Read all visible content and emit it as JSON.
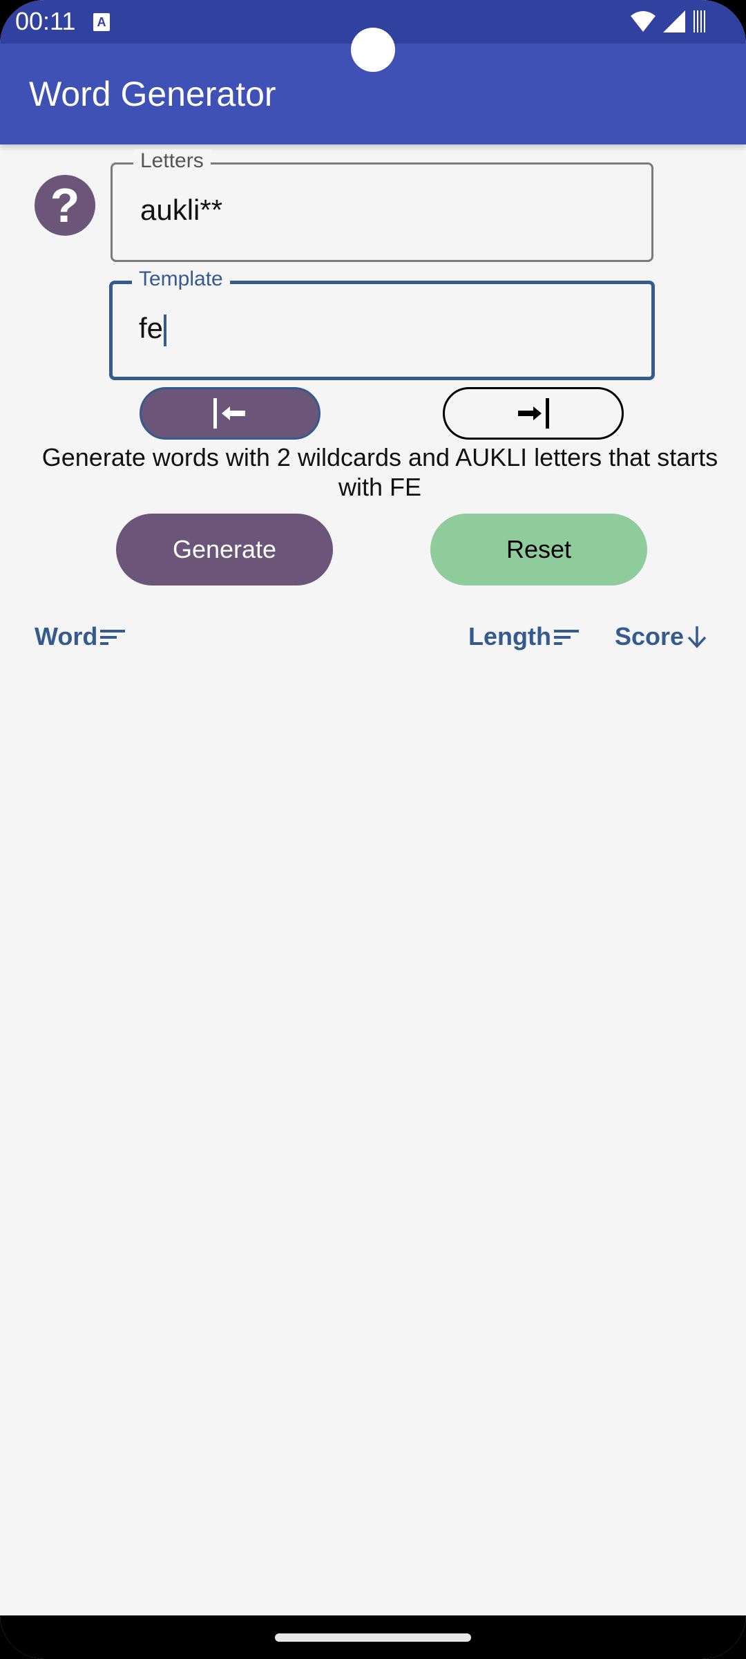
{
  "status_bar": {
    "time": "00:11",
    "notification_icon": "keyboard-a-icon",
    "icons": [
      "wifi-icon",
      "signal-icon",
      "battery-icon"
    ]
  },
  "app_bar": {
    "title": "Word Generator"
  },
  "help_button": {
    "icon": "question-icon",
    "glyph": "?"
  },
  "letters_field": {
    "label": "Letters",
    "value": "aukli**"
  },
  "template_field": {
    "label": "Template",
    "value": "fe"
  },
  "position_toggle": {
    "left": {
      "icon": "align-start-icon",
      "glyph": "|←",
      "selected": true
    },
    "right": {
      "icon": "align-end-icon",
      "glyph": "→|",
      "selected": false
    }
  },
  "description": "Generate words with 2 wildcards and AUKLI letters that starts with FE",
  "actions": {
    "generate_label": "Generate",
    "reset_label": "Reset"
  },
  "table": {
    "columns": [
      {
        "label": "Word",
        "sort_icon": "sort-icon"
      },
      {
        "label": "Length",
        "sort_icon": "sort-icon"
      },
      {
        "label": "Score",
        "sort_icon": "arrow-down-icon"
      }
    ],
    "rows": []
  },
  "colors": {
    "primary": "#3f51b5",
    "status_bar": "#3141a0",
    "accent_purple": "#6b5679",
    "accent_green": "#8ecc9c",
    "focus_blue": "#355a8e"
  }
}
